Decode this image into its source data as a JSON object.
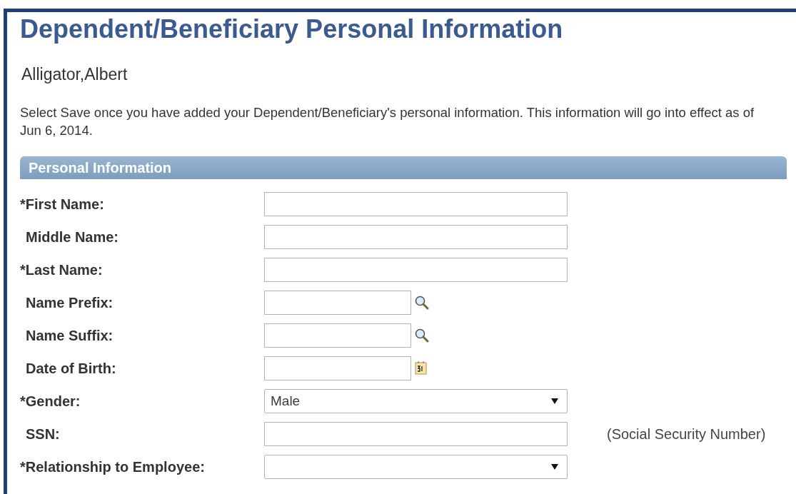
{
  "title": "Dependent/Beneficiary Personal Information",
  "employee_name": "Alligator,Albert",
  "instructions": "Select Save once you have added your Dependent/Beneficiary's personal information. This information will go into effect as of Jun 6, 2014.",
  "section": {
    "title": "Personal Information",
    "fields": [
      {
        "label": "*First Name:",
        "required": true,
        "kind": "text"
      },
      {
        "label": "Middle Name:",
        "required": false,
        "kind": "text"
      },
      {
        "label": "*Last Name:",
        "required": true,
        "kind": "text"
      },
      {
        "label": "Name Prefix:",
        "required": false,
        "kind": "lookup"
      },
      {
        "label": "Name Suffix:",
        "required": false,
        "kind": "lookup"
      },
      {
        "label": "Date of Birth:",
        "required": false,
        "kind": "date"
      },
      {
        "label": "*Gender:",
        "required": true,
        "kind": "select",
        "value": "Male"
      },
      {
        "label": "SSN:",
        "required": false,
        "kind": "text",
        "note": "(Social Security Number)"
      },
      {
        "label": "*Relationship to Employee:",
        "required": true,
        "kind": "select"
      }
    ]
  }
}
